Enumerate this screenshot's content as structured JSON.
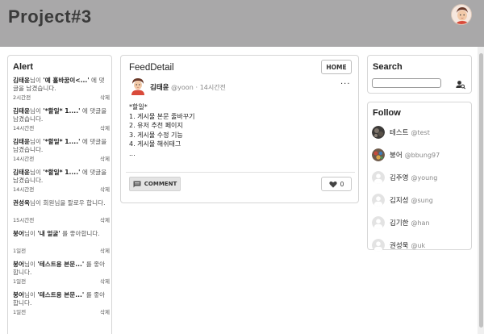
{
  "header": {
    "title": "Project#3"
  },
  "alert": {
    "title": "Alert",
    "delete_label": "삭제",
    "items": [
      {
        "user": "김태윤",
        "suffix": "님이",
        "target": "'예 홀바꿈이<...'",
        "action": "에 댓글을 남겼습니다.",
        "time": "2시간전"
      },
      {
        "user": "김태윤",
        "suffix": "님이",
        "target": "'*할일* 1....'",
        "action": "에 댓글을 남겼습니다.",
        "time": "14시간전"
      },
      {
        "user": "김태윤",
        "suffix": "님이",
        "target": "'*할일* 1....'",
        "action": "에 댓글을 남겼습니다.",
        "time": "14시간전"
      },
      {
        "user": "김태윤",
        "suffix": "님이",
        "target": "'*할일* 1....'",
        "action": "에 댓글을 남겼습니다.",
        "time": "14시간전"
      },
      {
        "user": "권성욱",
        "suffix": "님이",
        "target": "",
        "action": "회원님을 팔로우 합니다.",
        "time": "15시간전"
      },
      {
        "user": "붕어",
        "suffix": "님이",
        "target": "'내 얼굴'",
        "action": "를 좋아합니다.",
        "time": "1일전"
      },
      {
        "user": "붕어",
        "suffix": "님이",
        "target": "'테스트용 본문...'",
        "action": "를 좋아합니다.",
        "time": "1일전"
      },
      {
        "user": "붕어",
        "suffix": "님이",
        "target": "'테스트용 본문...'",
        "action": "를 좋아합니다.",
        "time": "1일전"
      }
    ]
  },
  "feed": {
    "title": "FeedDetail",
    "home_label": "HOME",
    "post": {
      "author": "김태윤",
      "handle": "@yoon",
      "separator": "·",
      "time": "14시간전",
      "more": "···",
      "lines": [
        "*할일*",
        "1. 게시물 본문 줄바꾸기",
        "2. 유저 추천 페이지",
        "3. 게시물 수정 기능",
        "4. 게시물 해쉬태그",
        "..."
      ],
      "comment_label": "COMMENT",
      "like_count": "0"
    }
  },
  "search": {
    "title": "Search",
    "value": "",
    "placeholder": ""
  },
  "follow": {
    "title": "Follow",
    "users": [
      {
        "name": "테스트",
        "handle": "@test",
        "avatar": "photo-dark"
      },
      {
        "name": "붕어",
        "handle": "@bbung97",
        "avatar": "photo-color"
      },
      {
        "name": "김주영",
        "handle": "@young",
        "avatar": "default"
      },
      {
        "name": "김지성",
        "handle": "@sung",
        "avatar": "default"
      },
      {
        "name": "김기한",
        "handle": "@han",
        "avatar": "default"
      },
      {
        "name": "권성욱",
        "handle": "@uk",
        "avatar": "default"
      }
    ]
  },
  "colors": {
    "header_bg": "#a9a8a9",
    "title_text": "#3a3a3a",
    "border": "#d6d6d6"
  }
}
